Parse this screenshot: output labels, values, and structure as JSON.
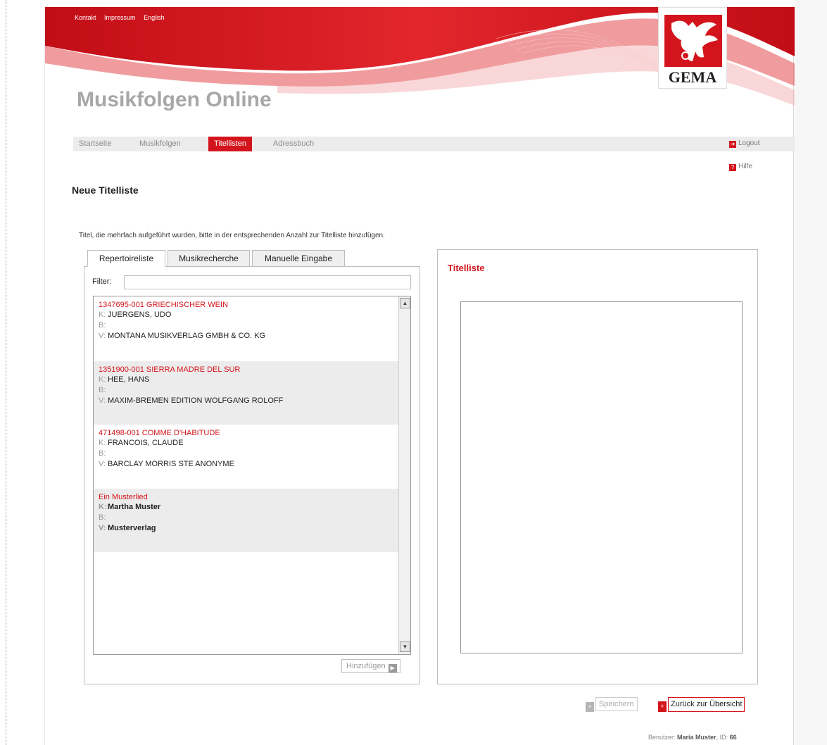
{
  "top_links": [
    "Kontakt",
    "Impressum",
    "English"
  ],
  "logo": {
    "text": "GEMA",
    "color": "#d4141c"
  },
  "app_title": "Musikfolgen Online",
  "nav": {
    "items": [
      "Startseite",
      "Musikfolgen",
      "Titellisten",
      "Adressbuch"
    ],
    "active": "Titellisten",
    "logout": "Logout",
    "help": "Hilfe"
  },
  "page_heading": "Neue Titelliste",
  "instruction": "Titel, die mehrfach aufgeführt wurden, bitte in der entsprechenden Anzahl zur Titelliste hinzufügen.",
  "tabs": [
    {
      "label": "Repertoireliste",
      "active": true
    },
    {
      "label": "Musikrecherche",
      "active": false
    },
    {
      "label": "Manuelle Eingabe",
      "active": false
    }
  ],
  "filter": {
    "label": "Filter:",
    "value": ""
  },
  "entries": [
    {
      "title": "1347695-001   GRIECHISCHER WEIN",
      "k": "JUERGENS, UDO",
      "b": "",
      "v": "MONTANA MUSIKVERLAG GMBH & CO. KG"
    },
    {
      "title": "1351900-001   SIERRA MADRE DEL SUR",
      "k": "HEE, HANS",
      "b": "",
      "v": "MAXIM-BREMEN EDITION WOLFGANG ROLOFF"
    },
    {
      "title": "471498-001   COMME D'HABITUDE",
      "k": "FRANCOIS, CLAUDE",
      "b": "",
      "v": "BARCLAY MORRIS STE ANONYME"
    },
    {
      "title": "Ein Musterlied",
      "k": "Martha Muster",
      "b": "",
      "v": "Musterverlag"
    }
  ],
  "field_keys": {
    "k": "K:",
    "b": "B:",
    "v": "V:"
  },
  "add_button": "Hinzufügen",
  "right_panel": {
    "title": "Titelliste"
  },
  "save_button": "Speichern",
  "back_button": "Zurück zur Übersicht",
  "footer": {
    "user_label": "Benutzer:",
    "user_name": "Maria Muster",
    "id_label": ", ID:",
    "id_value": "66"
  },
  "colors": {
    "accent": "#d4141c",
    "muted": "#a7a7a7"
  },
  "icons": {
    "logout": "logout-icon",
    "help": "help-icon",
    "add": "arrow-right-icon",
    "save": "plus-icon",
    "back": "plus-icon"
  }
}
